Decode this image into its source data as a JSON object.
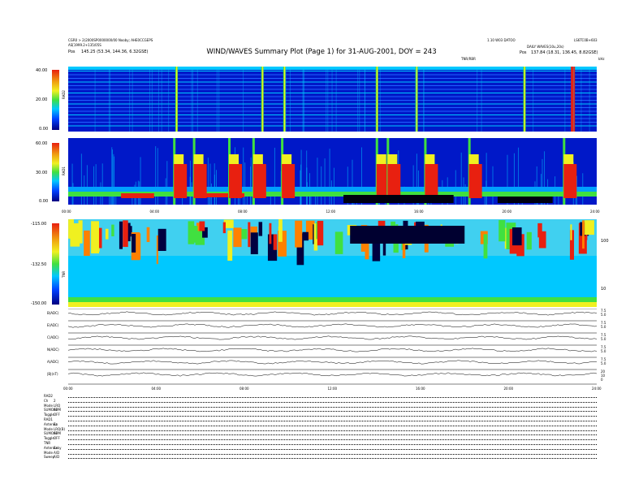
{
  "header": {
    "left_line1": "CGR0 > 2(2000SP0000000/00 Nooby; AHE0CCGEPS",
    "left_line2": "AS[1999.2+135/05S",
    "left_pos_label": "Pos",
    "left_pos_value": "145.25 (53.34, 144.36, 6.32GSE)",
    "right_line1": "1.10 W03 DATOO",
    "right_line2": "LS6TC0B+603",
    "right_line3": "DAILY WAVES(10u,20s)",
    "right_pos_label": "Pos",
    "right_pos_value": "137.84 (18.31, 136.45, 8.82GSE)",
    "title": "WIND/WAVES Summary Plot (Page 1) for 31-AUG-2001, DOY = 243",
    "sub_right_a": "TNR/RBR",
    "sub_right_b": "kHz"
  },
  "chart_data": [
    {
      "type": "heatmap",
      "name": "RAD2",
      "ylabel": "RAD2",
      "ylim": [
        0,
        40
      ],
      "y_ticks": [
        "40.00",
        "20.00",
        "0.00"
      ],
      "colormap": "jet",
      "events_hours": [
        4.9,
        8.8,
        9.8,
        14.0,
        15.8,
        20.7,
        22.9
      ],
      "background": "low"
    },
    {
      "type": "heatmap",
      "name": "RAD1",
      "ylabel": "RAD1",
      "ylim": [
        0,
        60
      ],
      "y_ticks": [
        "60.00",
        "30.00",
        "0.00"
      ],
      "x_ticks": [
        "00:00",
        "04:00",
        "08:00",
        "12:00",
        "16:00",
        "20:00",
        "24:00"
      ],
      "colormap": "jet",
      "events_hours": [
        4.8,
        5.7,
        7.3,
        8.4,
        9.7,
        14.0,
        14.5,
        16.2,
        18.2,
        22.5
      ]
    },
    {
      "type": "heatmap",
      "name": "TNR",
      "ylabel": "TNR",
      "ylim": [
        -150,
        -115
      ],
      "y_ticks": [
        "-115.00",
        "-132.50",
        "-150.00"
      ],
      "right_ticks": [
        "100",
        "10"
      ],
      "colormap": "jet"
    },
    {
      "type": "line",
      "traces": [
        {
          "label": "B(ADC)",
          "right_ticks": [
            "7.5",
            "5.0"
          ]
        },
        {
          "label": "E(ADC)",
          "right_ticks": [
            "7.5",
            "5.0"
          ]
        },
        {
          "label": "C(ADC)",
          "right_ticks": [
            "7.5",
            "5.0"
          ]
        },
        {
          "label": "N(ADC)",
          "right_ticks": [
            "7.5",
            "5.0"
          ]
        },
        {
          "label": "A(ADC)",
          "right_ticks": [
            "7.5",
            "5.0"
          ]
        },
        {
          "label": "|B|(nT)",
          "right_ticks": [
            "20",
            "10",
            "0"
          ]
        }
      ],
      "x_ticks": [
        "00:00",
        "04:00",
        "08:00",
        "12:00",
        "16:00",
        "20:00",
        "24:00"
      ]
    }
  ],
  "footer": {
    "rows": [
      {
        "a": "RAD2",
        "b": ""
      },
      {
        "a": "Ch",
        "b": "2"
      },
      {
        "a": "Mode",
        "b": "LRQ"
      },
      {
        "a": "SUMOAP",
        "b": "SUM"
      },
      {
        "a": "Toggle",
        "b": "OFF"
      },
      {
        "a": "RAD1",
        "b": ""
      },
      {
        "a": "Antenna",
        "b": "Ez"
      },
      {
        "a": "Mode",
        "b": "LRQ(B)"
      },
      {
        "a": "SUMOAP",
        "b": "SUM"
      },
      {
        "a": "Toggle",
        "b": "OFF"
      },
      {
        "a": "TNR",
        "b": ""
      },
      {
        "a": "Antenna",
        "b": "Exky"
      },
      {
        "a": "Mode",
        "b": "A/D"
      },
      {
        "a": "Sweep",
        "b": "A/D"
      }
    ]
  },
  "colors": {
    "low": "#0018c8",
    "mid": "#00c8ff",
    "green": "#40e040",
    "yellow": "#f0f020",
    "red": "#e82010"
  }
}
